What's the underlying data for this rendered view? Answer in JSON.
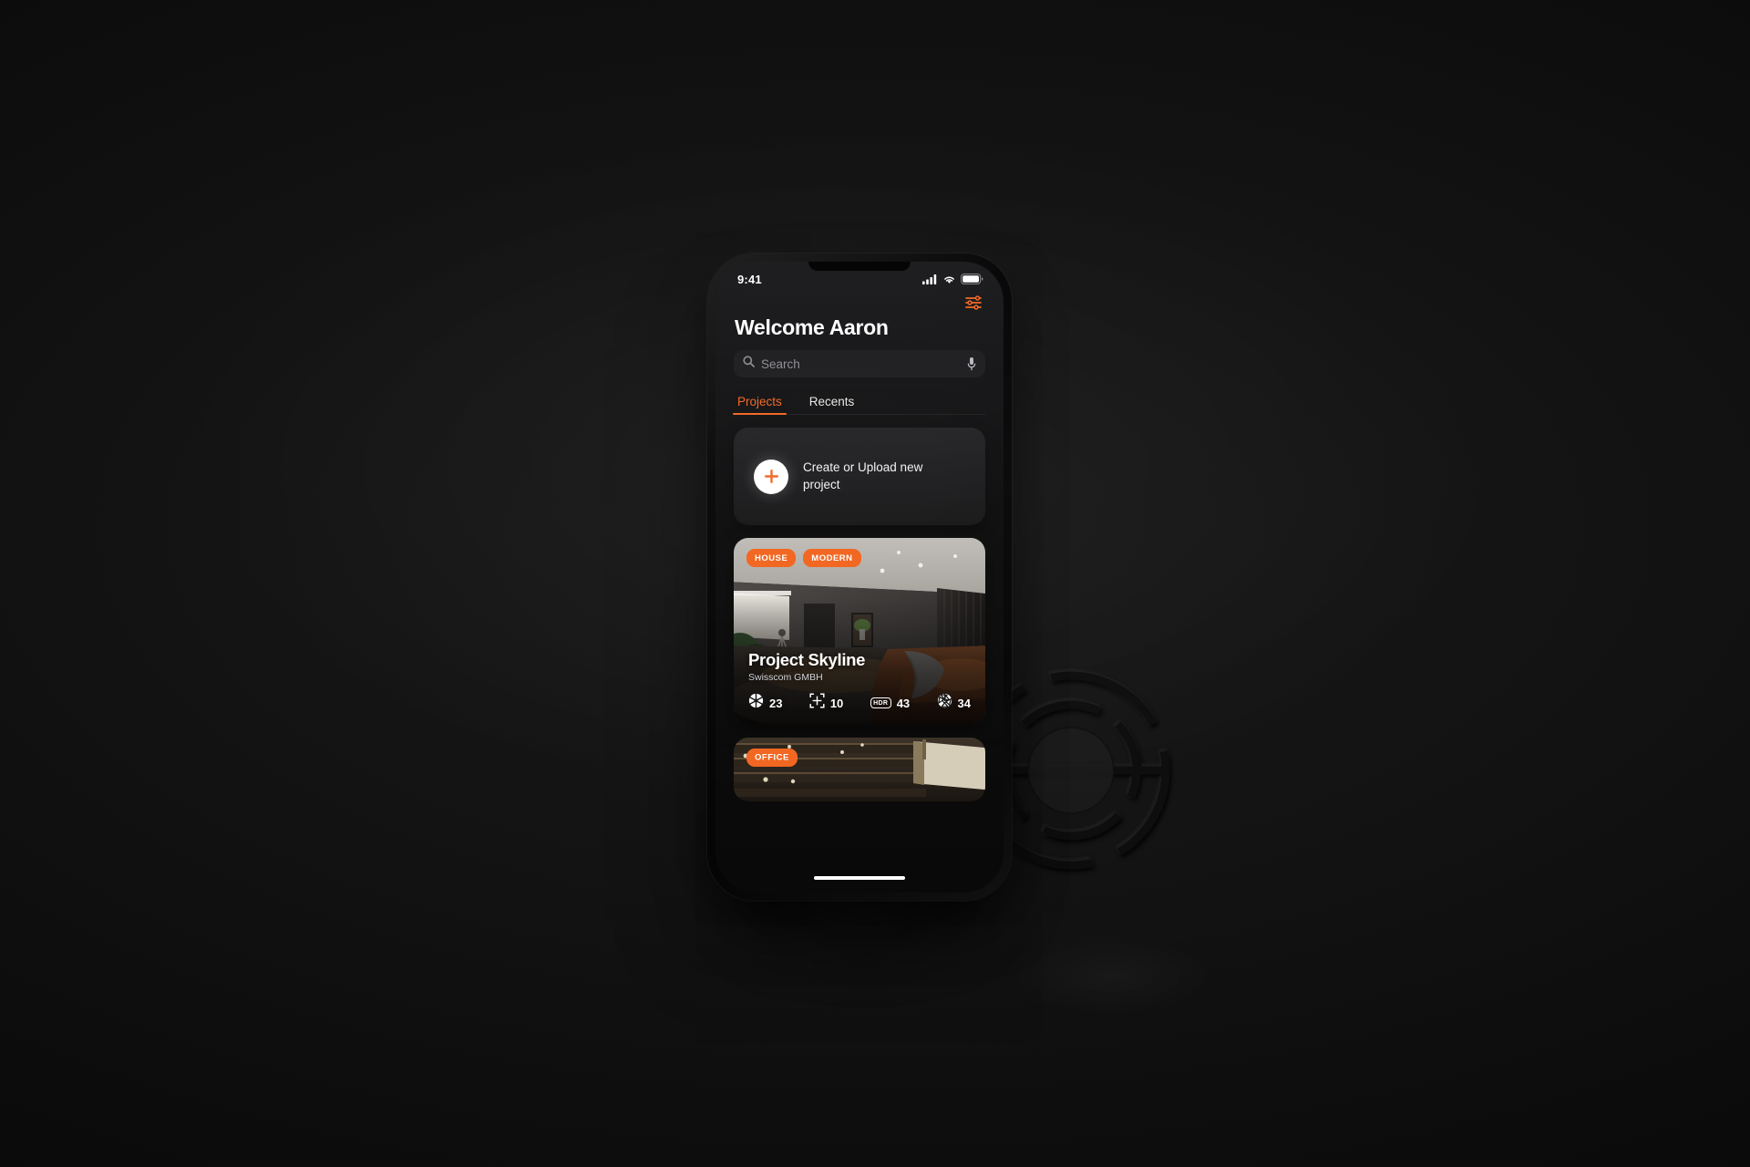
{
  "theme": {
    "accent": "#f26722",
    "screen_bg": "#0a0a0b",
    "card_bg": "#1b1b1d",
    "backdrop": "#0b0b0b",
    "text_primary": "#ffffff",
    "text_muted": "#8d8d93"
  },
  "status_bar": {
    "time": "9:41",
    "icons": [
      "cellular-signal-icon",
      "wifi-icon",
      "battery-icon"
    ]
  },
  "header": {
    "filter_button": {
      "icon": "sliders-filter-icon",
      "label": "Filters"
    },
    "greeting": "Welcome Aaron"
  },
  "search": {
    "icon": "search-icon",
    "placeholder": "Search",
    "value": "",
    "mic_icon": "microphone-icon"
  },
  "tabs": [
    {
      "label": "Projects",
      "active": true
    },
    {
      "label": "Recents",
      "active": false
    }
  ],
  "create_card": {
    "icon": "plus-icon",
    "label": "Create or Upload new project"
  },
  "projects": [
    {
      "tags": [
        "HOUSE",
        "MODERN"
      ],
      "title": "Project Skyline",
      "subtitle": "Swisscom GMBH",
      "stats": [
        {
          "icon": "aperture-icon",
          "value": "23"
        },
        {
          "icon": "floorplan-icon",
          "value": "10"
        },
        {
          "icon": "hdr-badge-icon",
          "value": "43",
          "badge_text": "HDR"
        },
        {
          "icon": "shutter-icon",
          "value": "34"
        }
      ]
    },
    {
      "tags": [
        "OFFICE"
      ],
      "title": "",
      "subtitle": "",
      "stats": []
    }
  ],
  "home_indicator": {
    "label": "home-indicator"
  },
  "backdrop": {
    "watermark_icon": "shutter-aperture-logo-watermark"
  }
}
